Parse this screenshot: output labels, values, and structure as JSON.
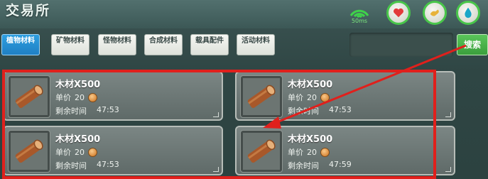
{
  "header": {
    "title": "交易所",
    "ping": "50ms",
    "buttons": [
      {
        "name": "heart-icon",
        "color": "#e23a3a"
      },
      {
        "name": "shake-hands-icon",
        "color": "#e7b23a"
      },
      {
        "name": "water-drop-icon",
        "color": "#18a6c8"
      }
    ]
  },
  "tabs": [
    {
      "label": "植物材料",
      "active": true
    },
    {
      "label": "矿物材料",
      "active": false
    },
    {
      "label": "怪物材料",
      "active": false
    },
    {
      "label": "合成材料",
      "active": false
    },
    {
      "label": "载具配件",
      "active": false
    },
    {
      "label": "活动材料",
      "active": false
    }
  ],
  "search": {
    "placeholder": "",
    "button_label": "搜索"
  },
  "listings": [
    {
      "name": "木材X500",
      "price_label": "单价",
      "price": "20",
      "time_label": "剩余时间",
      "time": "47:53",
      "icon": "wood-log-icon"
    },
    {
      "name": "木材X500",
      "price_label": "单价",
      "price": "20",
      "time_label": "剩余时间",
      "time": "47:53",
      "icon": "wood-log-icon"
    },
    {
      "name": "木材X500",
      "price_label": "单价",
      "price": "20",
      "time_label": "剩余时间",
      "time": "47:53",
      "icon": "wood-log-icon"
    },
    {
      "name": "木材X500",
      "price_label": "单价",
      "price": "20",
      "time_label": "剩余时间",
      "time": "47:59",
      "icon": "wood-log-icon"
    }
  ],
  "annotation": {
    "highlight_color": "#e0201c"
  }
}
